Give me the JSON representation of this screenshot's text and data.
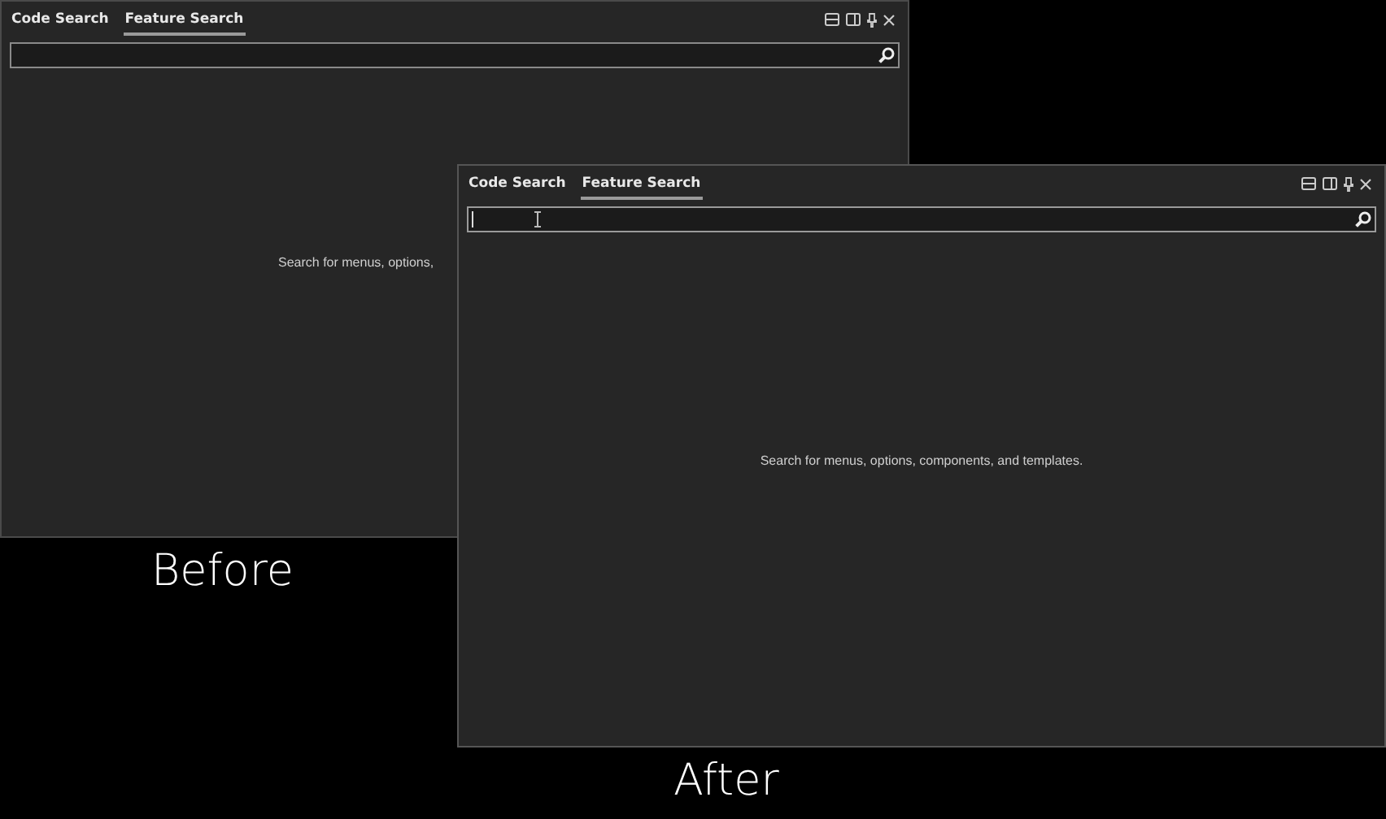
{
  "panels": [
    {
      "caption": "Before",
      "tabs": [
        {
          "label": "Code Search",
          "selected": false
        },
        {
          "label": "Feature Search",
          "selected": true
        }
      ],
      "search": {
        "focused": false
      },
      "hint": "Search for menus, options,"
    },
    {
      "caption": "After",
      "tabs": [
        {
          "label": "Code Search",
          "selected": false
        },
        {
          "label": "Feature Search",
          "selected": true
        }
      ],
      "search": {
        "focused": true
      },
      "hint": "Search for menus, options, components, and templates."
    }
  ]
}
